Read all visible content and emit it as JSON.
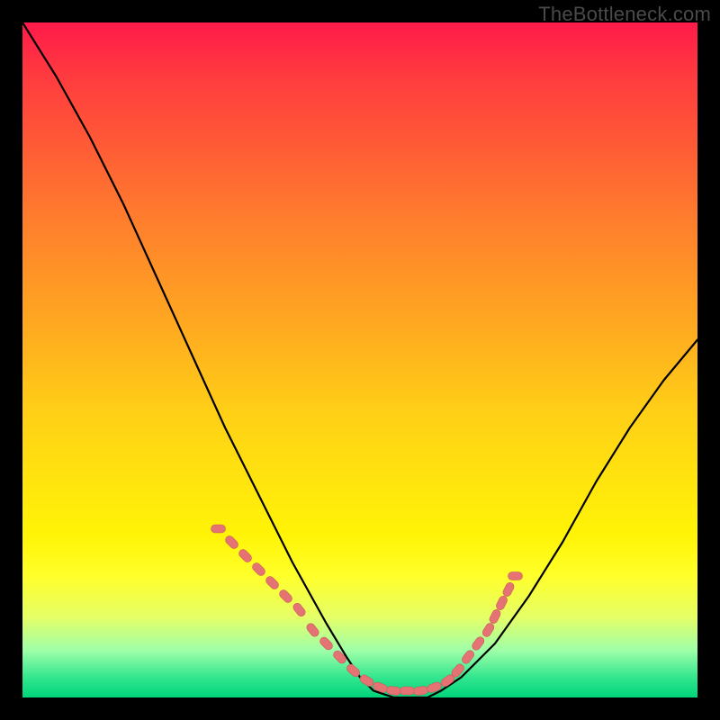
{
  "watermark": "TheBottleneck.com",
  "colors": {
    "curve": "#000000",
    "marker": "#e57373",
    "marker_stroke": "#c75a5a",
    "background_black": "#000000"
  },
  "chart_data": {
    "type": "line",
    "title": "",
    "xlabel": "",
    "ylabel": "",
    "xlim": [
      0,
      100
    ],
    "ylim": [
      0,
      100
    ],
    "grid": false,
    "series": [
      {
        "name": "curve",
        "x": [
          0,
          5,
          10,
          15,
          20,
          25,
          30,
          35,
          40,
          45,
          48,
          50,
          52,
          55,
          58,
          60,
          62,
          65,
          70,
          75,
          80,
          85,
          90,
          95,
          100
        ],
        "y": [
          100,
          92,
          83,
          73,
          62,
          51,
          40,
          30,
          20,
          11,
          6,
          3,
          1,
          0,
          0,
          0,
          1,
          3,
          8,
          15,
          23,
          32,
          40,
          47,
          53
        ]
      }
    ],
    "markers": {
      "name": "highlight-dots",
      "x": [
        29,
        31,
        33,
        35,
        37,
        39,
        41,
        43,
        45,
        47,
        49,
        51,
        53,
        55,
        57,
        59,
        61,
        63,
        64.5,
        66,
        67.5,
        69,
        70,
        71,
        72,
        73
      ],
      "y": [
        25,
        23,
        21,
        19,
        17,
        15,
        13,
        10,
        8,
        6,
        4,
        2.5,
        1.5,
        1,
        1,
        1,
        1.5,
        2.5,
        4,
        6,
        8,
        10,
        12,
        14,
        16,
        18
      ]
    }
  }
}
